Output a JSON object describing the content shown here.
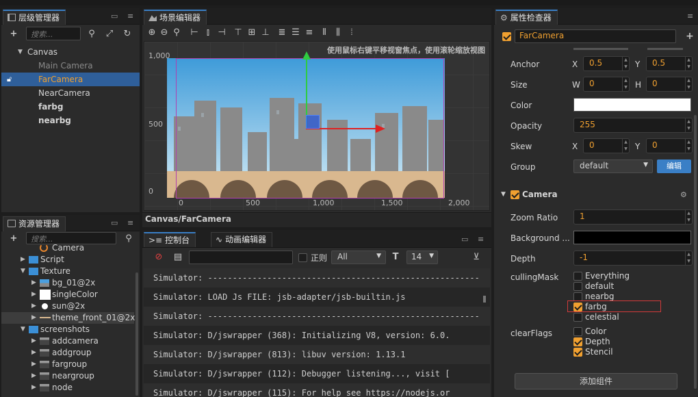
{
  "hierarchy": {
    "tab_label": "层级管理器",
    "search_placeholder": "搜索...",
    "nodes": [
      {
        "label": "Canvas",
        "depth": 0,
        "expanded": true
      },
      {
        "label": "Main Camera",
        "depth": 1,
        "dim": true
      },
      {
        "label": "FarCamera",
        "depth": 1,
        "selected": true
      },
      {
        "label": "NearCamera",
        "depth": 1
      },
      {
        "label": "farbg",
        "depth": 1
      },
      {
        "label": "nearbg",
        "depth": 1
      }
    ]
  },
  "scene": {
    "tab_label": "场景编辑器",
    "hint": "使用鼠标右键平移视窗焦点，使用滚轮缩放视图",
    "y_ticks": [
      "1,000",
      "500",
      "0"
    ],
    "x_ticks": [
      "0",
      "500",
      "1,000",
      "1,500",
      "2,000"
    ],
    "breadcrumb": "Canvas/FarCamera"
  },
  "assets": {
    "tab_label": "资源管理器",
    "search_placeholder": "搜索...",
    "items": [
      {
        "label": "Camera",
        "icon": "camera-icon"
      },
      {
        "label": "Script",
        "icon": "folder-icon"
      },
      {
        "label": "Texture",
        "icon": "folder-icon"
      },
      {
        "label": "bg_01@2x",
        "icon": "image-icon"
      },
      {
        "label": "singleColor",
        "icon": "white-image-icon"
      },
      {
        "label": "sun@2x",
        "icon": "circle-image-icon"
      },
      {
        "label": "theme_front_01@2x",
        "icon": "strip-image-icon"
      },
      {
        "label": "screenshots",
        "icon": "folder-icon"
      },
      {
        "label": "addcamera",
        "icon": "image-icon"
      },
      {
        "label": "addgroup",
        "icon": "image-icon"
      },
      {
        "label": "fargroup",
        "icon": "image-icon"
      },
      {
        "label": "neargroup",
        "icon": "image-icon"
      },
      {
        "label": "node",
        "icon": "image-icon"
      }
    ]
  },
  "console": {
    "tab_label": "控制台",
    "anim_tab_label": "动画编辑器",
    "regex_label": "正则",
    "level_value": "All",
    "font_size_value": "14",
    "lines": [
      "Simulator: -------------------------------------------------------",
      "Simulator: LOAD Js FILE: jsb-adapter/jsb-builtin.js",
      "Simulator: -------------------------------------------------------",
      "Simulator: D/jswrapper (368): Initializing V8, version: 6.0.",
      "Simulator: D/jswrapper (813): libuv version: 1.13.1",
      "Simulator: D/jswrapper (112): Debugger listening..., visit [",
      "Simulator: D/jswrapper (115): For help see https://nodejs.or"
    ]
  },
  "inspector": {
    "tab_label": "属性检查器",
    "node_name": "FarCamera",
    "anchor_label": "Anchor",
    "anchor_x": "0.5",
    "anchor_y": "0.5",
    "size_label": "Size",
    "size_w": "0",
    "size_h": "0",
    "color_label": "Color",
    "opacity_label": "Opacity",
    "opacity": "255",
    "skew_label": "Skew",
    "skew_x": "0",
    "skew_y": "0",
    "group_label": "Group",
    "group_value": "default",
    "edit_label": "编辑",
    "x_label": "X",
    "y_label": "Y",
    "w_label": "W",
    "h_label": "H",
    "camera_title": "Camera",
    "zoom_label": "Zoom Ratio",
    "zoom_value": "1",
    "bg_label": "Background ...",
    "depth_label": "Depth",
    "depth_value": "-1",
    "culling_label": "cullingMask",
    "culling_options": [
      {
        "label": "Everything",
        "checked": false
      },
      {
        "label": "default",
        "checked": false
      },
      {
        "label": "nearbg",
        "checked": false
      },
      {
        "label": "farbg",
        "checked": true
      },
      {
        "label": "celestial",
        "checked": false
      }
    ],
    "clearflags_label": "clearFlags",
    "clear_options": [
      {
        "label": "Color",
        "checked": false
      },
      {
        "label": "Depth",
        "checked": true
      },
      {
        "label": "Stencil",
        "checked": true
      }
    ],
    "add_component": "添加组件"
  },
  "colors": {
    "accent": "#f0a030",
    "selection": "#2f5f9a",
    "edit_button": "#3a7fc6",
    "highlight_box": "#d23a3a"
  }
}
